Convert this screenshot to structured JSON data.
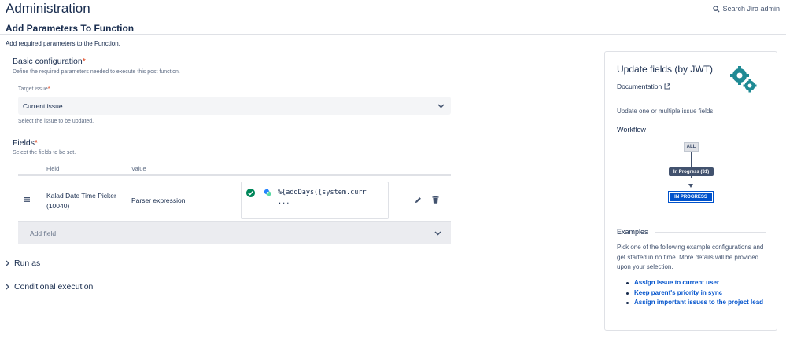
{
  "header": {
    "title": "Administration",
    "search_label": "Search Jira admin",
    "subtitle": "Add Parameters To Function",
    "description": "Add required parameters to the Function."
  },
  "basic_config": {
    "title": "Basic configuration",
    "required_mark": "*",
    "description": "Define the required parameters needed to execute this post function.",
    "target_label": "Target issue",
    "target_required": "*",
    "target_value": "Current issue",
    "target_help": "Select the issue to be updated."
  },
  "fields": {
    "title": "Fields",
    "required_mark": "*",
    "description": "Select the fields to be set.",
    "col_field": "Field",
    "col_value": "Value",
    "rows": [
      {
        "field_name": "Kalad Date Time Picker",
        "field_id": "(10040)",
        "value_type": "Parser expression",
        "expression": "%{addDays({system.curr",
        "expression_more": "..."
      }
    ],
    "add_field_placeholder": "Add field"
  },
  "sections": {
    "run_as": "Run as",
    "conditional": "Conditional execution"
  },
  "panel": {
    "title": "Update fields (by JWT)",
    "documentation": "Documentation",
    "description": "Update one or multiple issue fields.",
    "workflow_title": "Workflow",
    "wf_all": "ALL",
    "wf_transition": "In Progress (31)",
    "wf_status": "IN PROGRESS",
    "examples_title": "Examples",
    "examples_text": "Pick one of the following example configurations and get started in no time. More details will be provided upon your selection.",
    "examples": [
      "Assign issue to current user",
      "Keep parent's priority in sync",
      "Assign important issues to the project lead"
    ]
  },
  "colors": {
    "link": "#0052cc",
    "required": "#de350b",
    "success": "#00875a",
    "status_blue": "#0052cc",
    "transition_dark": "#42526e",
    "gear_teal": "#1f8a94"
  },
  "icons": {
    "search": "search-icon",
    "chevron": "chevron-down-icon",
    "drag": "drag-handle-icon",
    "check": "check-circle-icon",
    "parser": "parser-icon",
    "edit": "pencil-icon",
    "delete": "trash-icon",
    "external": "external-link-icon",
    "gears": "gears-icon"
  }
}
